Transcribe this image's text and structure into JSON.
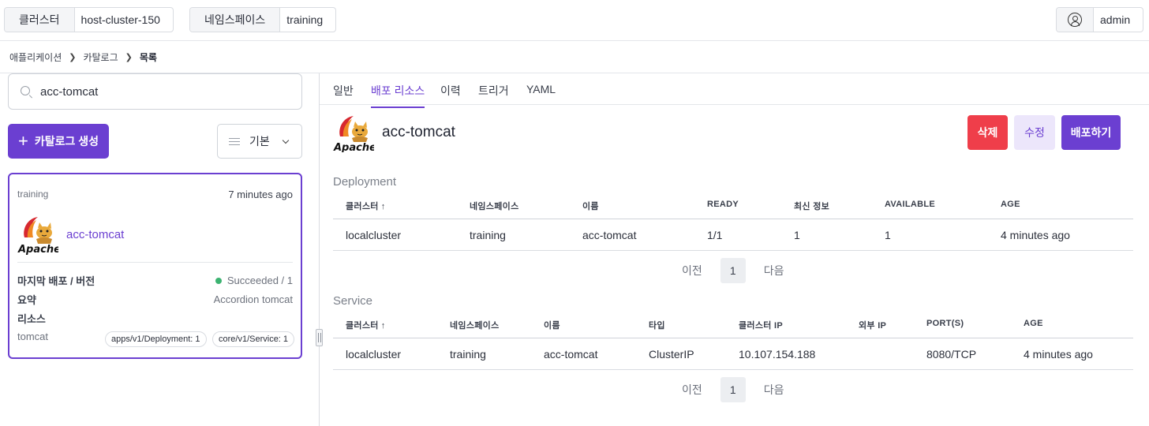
{
  "topbar": {
    "cluster_label": "클러스터",
    "cluster_value": "host-cluster-150",
    "namespace_label": "네임스페이스",
    "namespace_value": "training",
    "user_name": "admin"
  },
  "breadcrumb": [
    "애플리케이션",
    "카탈로그",
    "목록"
  ],
  "left": {
    "search_value": "acc-tomcat",
    "create_button": "카탈로그 생성",
    "sort_label": "기본",
    "card": {
      "namespace": "training",
      "time_ago": "7 minutes ago",
      "name": "acc-tomcat",
      "last_deploy_label": "마지막 배포 / 버전",
      "last_deploy_value": "Succeeded / 1",
      "summary_label": "요약",
      "summary_value": "Accordion tomcat",
      "resources_label": "리소스",
      "resource_name": "tomcat",
      "pills": [
        "apps/v1/Deployment: 1",
        "core/v1/Service: 1"
      ],
      "status_color": "#3cb371"
    }
  },
  "right": {
    "tabs": [
      "일반",
      "배포 리소스",
      "이력",
      "트리거",
      "YAML"
    ],
    "active_tab": "배포 리소스",
    "title": "acc-tomcat",
    "buttons": {
      "delete": "삭제",
      "edit": "수정",
      "deploy": "배포하기"
    },
    "deployment": {
      "section_title": "Deployment",
      "headers": [
        "클러스터",
        "네임스페이스",
        "이름",
        "READY",
        "최신 정보",
        "AVAILABLE",
        "AGE"
      ],
      "rows": [
        [
          "localcluster",
          "training",
          "acc-tomcat",
          "1/1",
          "1",
          "1",
          "4 minutes ago"
        ]
      ]
    },
    "service": {
      "section_title": "Service",
      "headers": [
        "클러스터",
        "네임스페이스",
        "이름",
        "타입",
        "클러스터 IP",
        "외부 IP",
        "PORT(S)",
        "AGE"
      ],
      "rows": [
        [
          "localcluster",
          "training",
          "acc-tomcat",
          "ClusterIP",
          "10.107.154.188",
          "",
          "8080/TCP",
          "4 minutes ago"
        ]
      ]
    },
    "pager": {
      "prev": "이전",
      "page": "1",
      "next": "다음"
    }
  },
  "colors": {
    "accent": "#6b3fd1",
    "danger": "#ef3e4a",
    "accent_light": "#ece6fb"
  }
}
